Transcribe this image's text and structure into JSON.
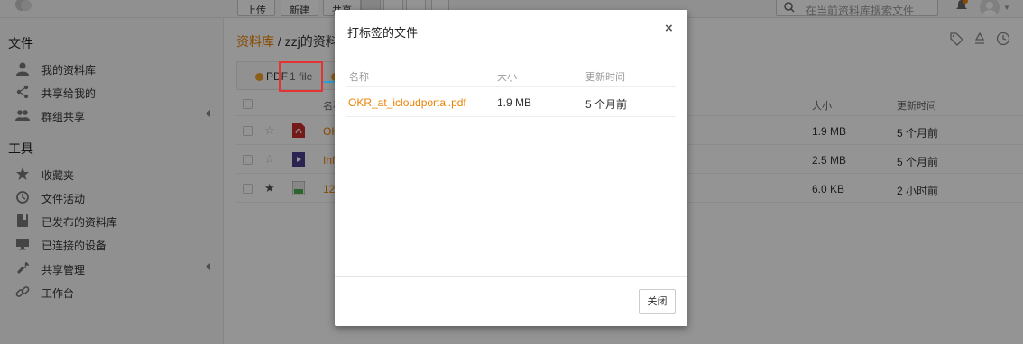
{
  "toolbar": {
    "upload_label": "上传",
    "new_label": "新建",
    "share_label": "共享",
    "search_placeholder": "在当前资料库搜索文件"
  },
  "sidebar": {
    "files_heading": "文件",
    "tools_heading": "工具",
    "files_items": [
      {
        "label": "我的资料库",
        "icon": "person-icon"
      },
      {
        "label": "共享给我的",
        "icon": "share-nodes-icon"
      },
      {
        "label": "群组共享",
        "icon": "group-icon"
      }
    ],
    "tools_items": [
      {
        "label": "收藏夹",
        "icon": "star-icon"
      },
      {
        "label": "文件活动",
        "icon": "history-icon"
      },
      {
        "label": "已发布的资料库",
        "icon": "book-icon"
      },
      {
        "label": "已连接的设备",
        "icon": "monitor-icon"
      },
      {
        "label": "共享管理",
        "icon": "wrench-icon"
      },
      {
        "label": "工作台",
        "icon": "link-icon"
      }
    ]
  },
  "breadcrumb": {
    "root": "资料库",
    "separator": " / ",
    "current": "zzj的资料库"
  },
  "tag_filter": {
    "name": "PDF",
    "count": "1 file",
    "color": "#f0a02a"
  },
  "file_list": {
    "columns": {
      "name": "名称",
      "size": "大小",
      "modified": "更新时间"
    },
    "rows": [
      {
        "name": "OKR_at_icloudportal.pdf",
        "name_visible": "OK",
        "size": "1.9 MB",
        "modified": "5 个月前",
        "starred": false,
        "icon": "pdf-file-icon"
      },
      {
        "name": "Inf",
        "name_visible": "Inf",
        "size": "2.5 MB",
        "modified": "5 个月前",
        "starred": false,
        "icon": "video-file-icon"
      },
      {
        "name": "12",
        "name_visible": "12",
        "size": "6.0 KB",
        "modified": "2 小时前",
        "starred": true,
        "icon": "spreadsheet-file-icon"
      }
    ]
  },
  "modal": {
    "title": "打标签的文件",
    "close_symbol": "×",
    "columns": {
      "name": "名称",
      "size": "大小",
      "modified": "更新时间"
    },
    "rows": [
      {
        "name": "OKR_at_icloudportal.pdf",
        "size": "1.9 MB",
        "modified": "5 个月前"
      }
    ],
    "close_button": "关闭"
  },
  "colors": {
    "accent": "#eb8205",
    "highlight": "#e53333",
    "arrow": "#2a9fd6"
  }
}
